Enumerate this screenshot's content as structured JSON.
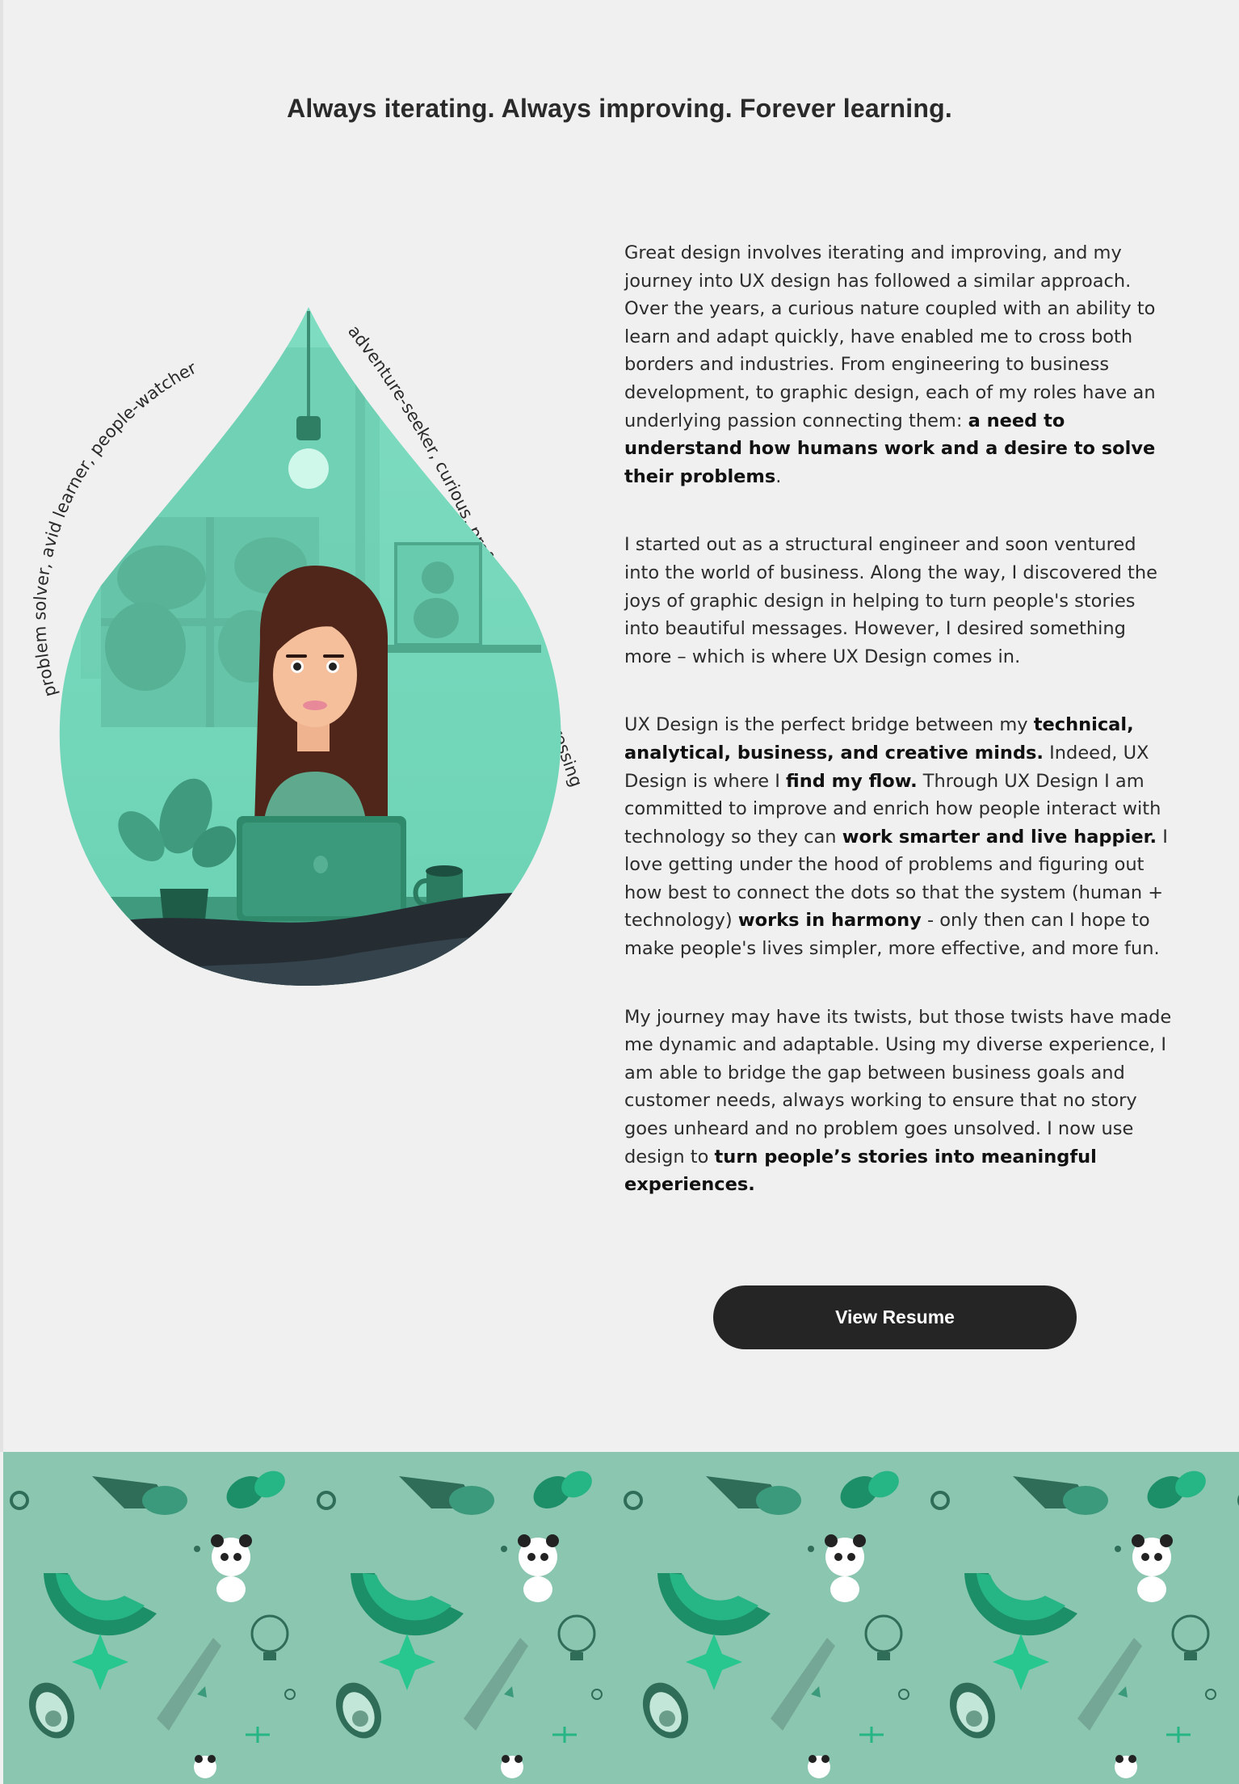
{
  "header": {
    "title": "Always iterating. Always improving. Forever learning."
  },
  "traits": {
    "left": "problem solver,   avid learner,   people-watcher",
    "right": "adventure-seeker,  curious,  prefers listening over expressing"
  },
  "bio": {
    "p1": {
      "text": "Great design involves iterating and improving, and my journey into UX design has followed a similar approach. Over the years, a curious nature coupled with an ability to learn and adapt quickly, have enabled me to cross both borders and industries. From engineering to business development, to graphic design, each of my roles have an underlying passion connecting them: ",
      "bold": "a need to understand how humans work and a desire to solve their problems",
      "end": "."
    },
    "p2": "I started out as a structural engineer and soon ventured into the world of business. Along the way, I discovered the joys of graphic design in helping to turn people's stories into beautiful messages. However, I desired something more – which is where UX Design comes in.",
    "p3": {
      "t1": "UX Design is the perfect bridge between my ",
      "b1": "technical, analytical, business, and creative minds.",
      "t2": " Indeed, UX Design is where I ",
      "b2": "find my flow.",
      "t3": " Through UX Design I am committed to improve and enrich how people interact with technology so they can ",
      "b3": "work smarter and live happier.",
      "t4": " I love getting under the hood of problems and figuring out how best to connect the dots so that the system (human + technology) ",
      "b4": "works in harmony",
      "t5": " - only then can I hope to make people's lives simpler, more effective, and more fun."
    },
    "p4": {
      "text": "My journey may have its twists, but those twists have made me dynamic and adaptable. Using my diverse experience, I am able to bridge the gap between business goals and customer needs, always working to ensure that no story goes unheard and no problem goes unsolved. I now use design to ",
      "bold": "turn people’s stories into meaningful experiences."
    }
  },
  "actions": {
    "resume_label": "View Resume"
  },
  "colors": {
    "mint": "#75d8bb",
    "dark_green": "#2e8a6a",
    "pattern_bg": "#8bc6b0",
    "button": "#252525",
    "page_bg": "#f0f0f0"
  }
}
